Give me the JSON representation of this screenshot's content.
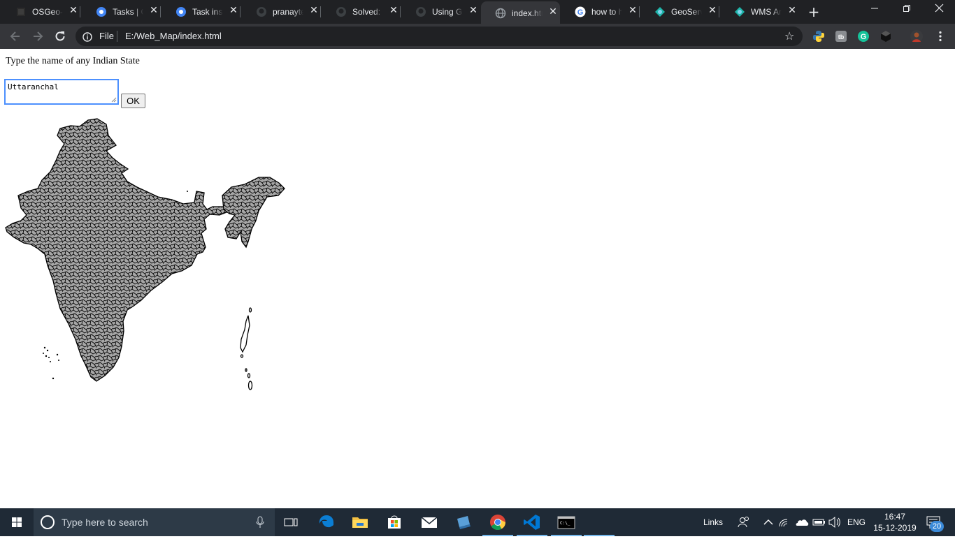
{
  "browser": {
    "tabs": [
      {
        "title": "OSGeo-G",
        "favicon": "osgeo-icon"
      },
      {
        "title": "Tasks | Go",
        "favicon": "gear-blue-icon"
      },
      {
        "title": "Task insta",
        "favicon": "gear-blue-icon"
      },
      {
        "title": "pranaytes",
        "favicon": "github-icon"
      },
      {
        "title": "Solved: H",
        "favicon": "github-icon"
      },
      {
        "title": "Using Git",
        "favicon": "github-icon"
      },
      {
        "title": "index.htm",
        "favicon": "globe-icon",
        "active": true
      },
      {
        "title": "how to hi",
        "favicon": "google-icon"
      },
      {
        "title": "GeoServe",
        "favicon": "geoserver-icon"
      },
      {
        "title": "WMS Ani",
        "favicon": "geoserver-icon"
      }
    ],
    "address": {
      "scheme_label": "File",
      "url": "E:/Web_Map/index.html"
    }
  },
  "page": {
    "prompt": "Type the name of any Indian State",
    "input_value": "Uttaranchal",
    "ok_label": "OK"
  },
  "map": {
    "subject": "India district boundaries",
    "fill": "#a6a6a6",
    "stroke": "#000000"
  },
  "taskbar": {
    "search_placeholder": "Type here to search",
    "links_label": "Links",
    "language": "ENG",
    "time": "16:47",
    "date": "15-12-2019",
    "notification_count": "20"
  }
}
